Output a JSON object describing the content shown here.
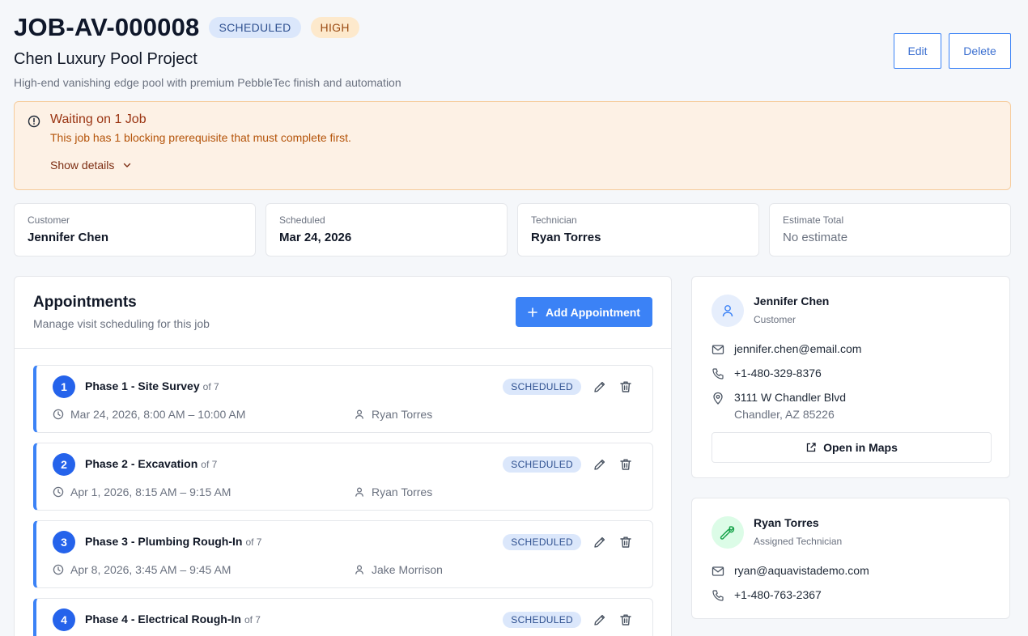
{
  "header": {
    "job_id": "JOB-AV-000008",
    "status_badge": "SCHEDULED",
    "priority_badge": "HIGH",
    "title": "Chen Luxury Pool Project",
    "description": "High-end vanishing edge pool with premium PebbleTec finish and automation",
    "edit_label": "Edit",
    "delete_label": "Delete"
  },
  "alert": {
    "title": "Waiting on 1 Job",
    "text": "This job has 1 blocking prerequisite that must complete first.",
    "toggle_label": "Show details"
  },
  "stats": [
    {
      "label": "Customer",
      "value": "Jennifer Chen"
    },
    {
      "label": "Scheduled",
      "value": "Mar 24, 2026"
    },
    {
      "label": "Technician",
      "value": "Ryan Torres"
    },
    {
      "label": "Estimate Total",
      "value": "No estimate"
    }
  ],
  "appointments": {
    "title": "Appointments",
    "subtitle": "Manage visit scheduling for this job",
    "add_label": "Add Appointment",
    "items": [
      {
        "num": "1",
        "name": "Phase 1 - Site Survey",
        "of": "of 7",
        "status": "SCHEDULED",
        "time": "Mar 24, 2026, 8:00 AM – 10:00 AM",
        "tech": "Ryan Torres"
      },
      {
        "num": "2",
        "name": "Phase 2 - Excavation",
        "of": "of 7",
        "status": "SCHEDULED",
        "time": "Apr 1, 2026, 8:15 AM – 9:15 AM",
        "tech": "Ryan Torres"
      },
      {
        "num": "3",
        "name": "Phase 3 - Plumbing Rough-In",
        "of": "of 7",
        "status": "SCHEDULED",
        "time": "Apr 8, 2026, 3:45 AM – 9:45 AM",
        "tech": "Jake Morrison"
      },
      {
        "num": "4",
        "name": "Phase 4 - Electrical Rough-In",
        "of": "of 7",
        "status": "SCHEDULED",
        "time": "",
        "tech": ""
      }
    ]
  },
  "customer": {
    "name": "Jennifer Chen",
    "role": "Customer",
    "email": "jennifer.chen@email.com",
    "phone": "+1-480-329-8376",
    "address_line1": "3111 W Chandler Blvd",
    "address_line2": "Chandler, AZ 85226",
    "maps_label": "Open in Maps"
  },
  "technician": {
    "name": "Ryan Torres",
    "role": "Assigned Technician",
    "email": "ryan@aquavistademo.com",
    "phone": "+1-480-763-2367"
  },
  "colors": {
    "accent": "#3b82f6",
    "badge_blue_bg": "#dbe7fb",
    "badge_orange_bg": "#fde9cc",
    "alert_bg": "#fdf1e5"
  }
}
